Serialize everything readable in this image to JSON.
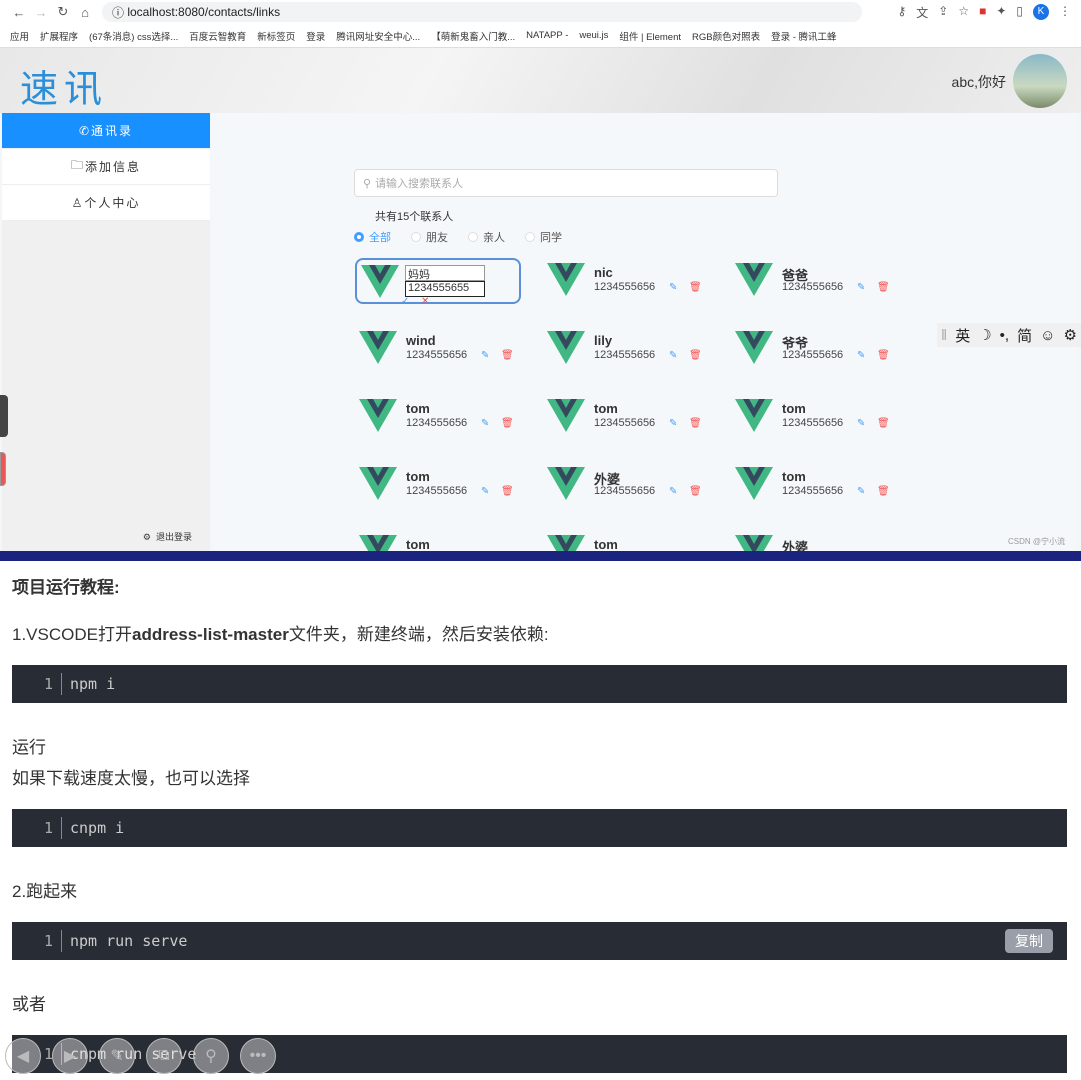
{
  "browser": {
    "url": "localhost:8080/contacts/links",
    "bookmarks": [
      "应用",
      "扩展程序",
      "(67条消息) css选择...",
      "百度云智教育",
      "新标签页",
      "登录",
      "腾讯网址安全中心...",
      "【萌新鬼畜入门教...",
      "NATAPP -",
      "weui.js",
      "组件 | Element",
      "RGB颜色对照表",
      "登录 - 腾讯工蜂"
    ],
    "profile": "K"
  },
  "app": {
    "logo": "速讯",
    "greeting": "abc,你好",
    "sidebar": [
      {
        "label": "通讯录",
        "icon": "phone-icon",
        "active": true
      },
      {
        "label": "添加信息",
        "icon": "folder-icon"
      },
      {
        "label": "个人中心",
        "icon": "user-icon"
      }
    ],
    "logout": "退出登录",
    "search_placeholder": "请输入搜索联系人",
    "count": "共有15个联系人",
    "filters": [
      {
        "label": "全部",
        "selected": true
      },
      {
        "label": "朋友"
      },
      {
        "label": "亲人"
      },
      {
        "label": "同学"
      }
    ],
    "editing": {
      "name": "妈妈",
      "phone": "1234555655"
    },
    "contacts": [
      {
        "name": "nic",
        "phone": "1234555656"
      },
      {
        "name": "爸爸",
        "phone": "1234555656"
      },
      {
        "name": "wind",
        "phone": "1234555656"
      },
      {
        "name": "lily",
        "phone": "1234555656"
      },
      {
        "name": "爷爷",
        "phone": "1234555656"
      },
      {
        "name": "tom",
        "phone": "1234555656"
      },
      {
        "name": "tom",
        "phone": "1234555656"
      },
      {
        "name": "tom",
        "phone": "1234555656"
      },
      {
        "name": "tom",
        "phone": "1234555656"
      },
      {
        "name": "外婆",
        "phone": "1234555656"
      },
      {
        "name": "tom",
        "phone": "1234555656"
      },
      {
        "name": "tom",
        "phone": ""
      },
      {
        "name": "tom",
        "phone": ""
      },
      {
        "name": "外婆",
        "phone": ""
      }
    ],
    "watermark": "CSDN @宁小流"
  },
  "ime": [
    "英",
    "☽",
    "•,",
    "简",
    "☺",
    "⚙"
  ],
  "article": {
    "heading": "项目运行教程:",
    "step1_pre": "1.VSCODE打开",
    "step1_bold": "address-list-master",
    "step1_post": "文件夹，新建终端，然后安装依赖:",
    "code1": "npm i",
    "run": "运行",
    "slow": "如果下载速度太慢，也可以选择",
    "code2": "cnpm i",
    "step2": "2.跑起来",
    "code3": "npm run serve",
    "copy": "复制",
    "or": "或者",
    "code4": "cnpm run serve",
    "line": "1"
  }
}
